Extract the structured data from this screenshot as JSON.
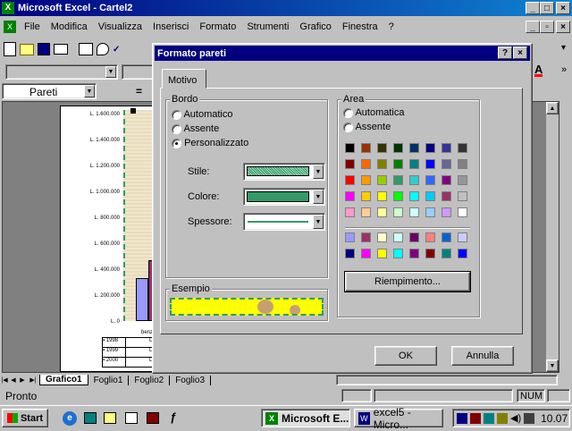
{
  "app": {
    "title": "Microsoft Excel - Cartel2"
  },
  "menu": [
    "File",
    "Modifica",
    "Visualizza",
    "Inserisci",
    "Formato",
    "Strumenti",
    "Grafico",
    "Finestra",
    "?"
  ],
  "name_box": "Pareti",
  "formula_eq": "=",
  "chart": {
    "y_ticks": [
      "L. 1.600.000",
      "L. 1.400.000",
      "L. 1.200.000",
      "L. 1.000.000",
      "L. 800.000",
      "L. 600.000",
      "L. 400.000",
      "L. 200.000",
      "L. 0"
    ],
    "x_label": "benz",
    "legend": [
      "1998",
      "1999",
      "2000"
    ],
    "table_mark": "L"
  },
  "sheet_tabs": [
    "Grafico1",
    "Foglio1",
    "Foglio2",
    "Foglio3"
  ],
  "status": {
    "text": "Pronto",
    "num": "NUM"
  },
  "dialog": {
    "title": "Formato pareti",
    "help_btn": "?",
    "close_btn": "×",
    "tab": "Motivo",
    "border": {
      "label": "Bordo",
      "options": [
        "Automatico",
        "Assente",
        "Personalizzato"
      ],
      "selected": "Personalizzato",
      "style_label": "Stile:",
      "color_label": "Colore:",
      "weight_label": "Spessore:",
      "color_value": "#339966"
    },
    "area": {
      "label": "Area",
      "options": [
        "Automatica",
        "Assente"
      ],
      "palette": [
        [
          "#000000",
          "#993300",
          "#333300",
          "#003300",
          "#003366",
          "#000080",
          "#333399",
          "#333333"
        ],
        [
          "#800000",
          "#ff6600",
          "#808000",
          "#008000",
          "#008080",
          "#0000ff",
          "#666699",
          "#808080"
        ],
        [
          "#ff0000",
          "#ff9900",
          "#99cc00",
          "#339966",
          "#33cccc",
          "#3366ff",
          "#800080",
          "#969696"
        ],
        [
          "#ff00ff",
          "#ffcc00",
          "#ffff00",
          "#00ff00",
          "#00ffff",
          "#00ccff",
          "#993366",
          "#c0c0c0"
        ],
        [
          "#ff99cc",
          "#ffcc99",
          "#ffff99",
          "#ccffcc",
          "#ccffff",
          "#99ccff",
          "#cc99ff",
          "#ffffff"
        ]
      ],
      "palette_extra": [
        [
          "#9999ff",
          "#993366",
          "#ffffcc",
          "#ccffff",
          "#660066",
          "#ff8080",
          "#0066cc",
          "#ccccff"
        ],
        [
          "#000080",
          "#ff00ff",
          "#ffff00",
          "#00ffff",
          "#800080",
          "#800000",
          "#008080",
          "#0000ff"
        ]
      ],
      "fill_btn": "Riempimento..."
    },
    "sample_label": "Esempio",
    "ok": "OK",
    "cancel": "Annulla"
  },
  "taskbar": {
    "start": "Start",
    "tasks": [
      "Microsoft E...",
      "excel5 - Micro..."
    ],
    "time": "10.07"
  }
}
